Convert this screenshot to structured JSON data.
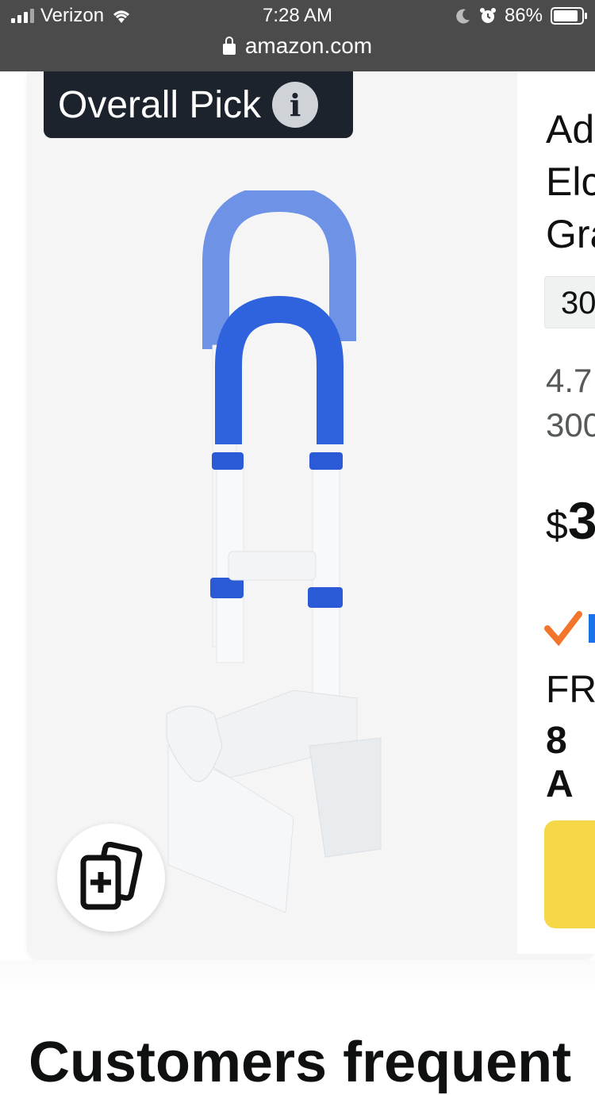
{
  "status_bar": {
    "carrier": "Verizon",
    "time": "7:28 AM",
    "battery": "86%",
    "url": "amazon.com"
  },
  "product": {
    "badge_label": "Overall Pick",
    "title_lines": [
      "Ad",
      "Elc",
      "Gra"
    ],
    "size_chip": "30",
    "rating_lines": [
      "4.7",
      "300"
    ],
    "price_symbol": "$",
    "price_digit": "3",
    "free_text": "FR",
    "delivery_text": "8 A",
    "colors": {
      "brand_badge": "#1c232c",
      "add_to_cart": "#f6d748",
      "prime_check": "#f3752b",
      "prime_blue": "#1a73e8"
    }
  },
  "section": {
    "heading": "Customers frequent"
  }
}
